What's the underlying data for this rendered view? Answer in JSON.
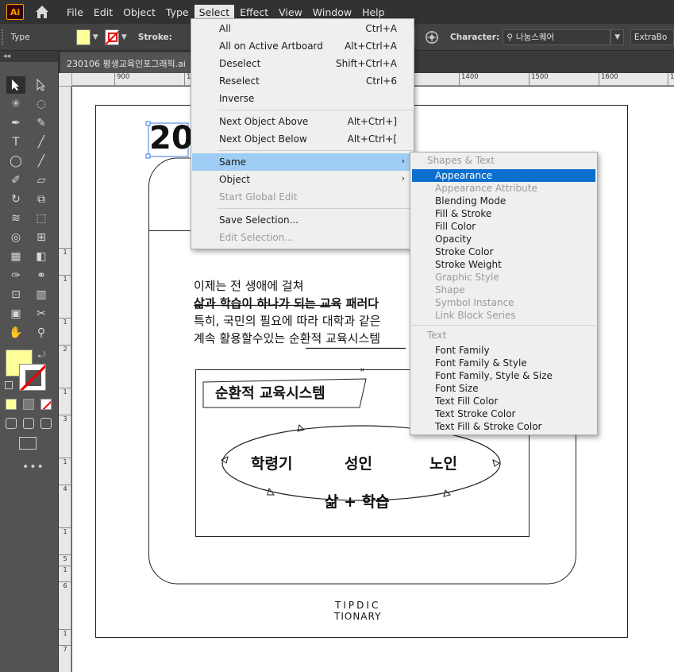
{
  "menubar": {
    "logo": "Ai",
    "items": [
      "File",
      "Edit",
      "Object",
      "Type",
      "Select",
      "Effect",
      "View",
      "Window",
      "Help"
    ],
    "active": "Select"
  },
  "controlbar": {
    "type_label": "Type",
    "stroke_label": "Stroke:",
    "character_label": "Character:",
    "font_name": "나눔스퀘어",
    "font_style": "ExtraBo"
  },
  "document": {
    "tab_title": "230106 평생교육인포그래픽.ai"
  },
  "tools": {
    "collapse_label": "◂◂"
  },
  "ruler": {
    "top_ticks": [
      "900",
      "10",
      "1400",
      "1500",
      "1600",
      "17"
    ],
    "left_ticks": [
      "1",
      "1",
      "1",
      "2",
      "1",
      "3",
      "1",
      "4",
      "1",
      "5",
      "1",
      "6",
      "1",
      "7"
    ]
  },
  "artwork": {
    "heading_fragment": "20",
    "paragraph_lines": [
      "이제는 전 생애에 걸쳐",
      "삶과 학습이 하나가 되는 교육 패러다",
      "특히, 국민의 필요에 따라 대학과 같은",
      "계속 활용할수있는 순환적 교육시스템"
    ],
    "system_title": "순환적 교육시스템",
    "cycle_labels": [
      "학령기",
      "성인",
      "노인"
    ],
    "cycle_center": "삶 + 학습",
    "logo_line1": "TIPDIC",
    "logo_line2": "TIONARY"
  },
  "select_menu": {
    "items": [
      {
        "label": "All",
        "shortcut": "Ctrl+A",
        "disabled": false
      },
      {
        "label": "All on Active Artboard",
        "shortcut": "Alt+Ctrl+A",
        "disabled": false
      },
      {
        "label": "Deselect",
        "shortcut": "Shift+Ctrl+A",
        "disabled": false
      },
      {
        "label": "Reselect",
        "shortcut": "Ctrl+6",
        "disabled": false
      },
      {
        "label": "Inverse",
        "shortcut": "",
        "disabled": false
      },
      {
        "label": "Next Object Above",
        "shortcut": "Alt+Ctrl+]",
        "disabled": false
      },
      {
        "label": "Next Object Below",
        "shortcut": "Alt+Ctrl+[",
        "disabled": false
      },
      {
        "label": "Same",
        "shortcut": "",
        "disabled": false
      },
      {
        "label": "Object",
        "shortcut": "",
        "disabled": false
      },
      {
        "label": "Start Global Edit",
        "shortcut": "",
        "disabled": true
      },
      {
        "label": "Save Selection...",
        "shortcut": "",
        "disabled": false
      },
      {
        "label": "Edit Selection...",
        "shortcut": "",
        "disabled": true
      }
    ]
  },
  "same_submenu": {
    "shapes_header": "Shapes & Text",
    "shapes_items": [
      {
        "label": "Appearance",
        "disabled": false
      },
      {
        "label": "Appearance Attribute",
        "disabled": true
      },
      {
        "label": "Blending Mode",
        "disabled": false
      },
      {
        "label": "Fill & Stroke",
        "disabled": false
      },
      {
        "label": "Fill Color",
        "disabled": false
      },
      {
        "label": "Opacity",
        "disabled": false
      },
      {
        "label": "Stroke Color",
        "disabled": false
      },
      {
        "label": "Stroke Weight",
        "disabled": false
      },
      {
        "label": "Graphic Style",
        "disabled": true
      },
      {
        "label": "Shape",
        "disabled": true
      },
      {
        "label": "Symbol Instance",
        "disabled": true
      },
      {
        "label": "Link Block Series",
        "disabled": true
      }
    ],
    "text_header": "Text",
    "text_items": [
      {
        "label": "Font Family",
        "disabled": false
      },
      {
        "label": "Font Family & Style",
        "disabled": false
      },
      {
        "label": "Font Family, Style & Size",
        "disabled": false
      },
      {
        "label": "Font Size",
        "disabled": false
      },
      {
        "label": "Text Fill Color",
        "disabled": false
      },
      {
        "label": "Text Stroke Color",
        "disabled": false
      },
      {
        "label": "Text Fill & Stroke Color",
        "disabled": false
      }
    ]
  },
  "colors": {
    "fill": "#ffff99",
    "highlight": "#0b6fd0",
    "menu_hover": "#9fcdf5"
  }
}
